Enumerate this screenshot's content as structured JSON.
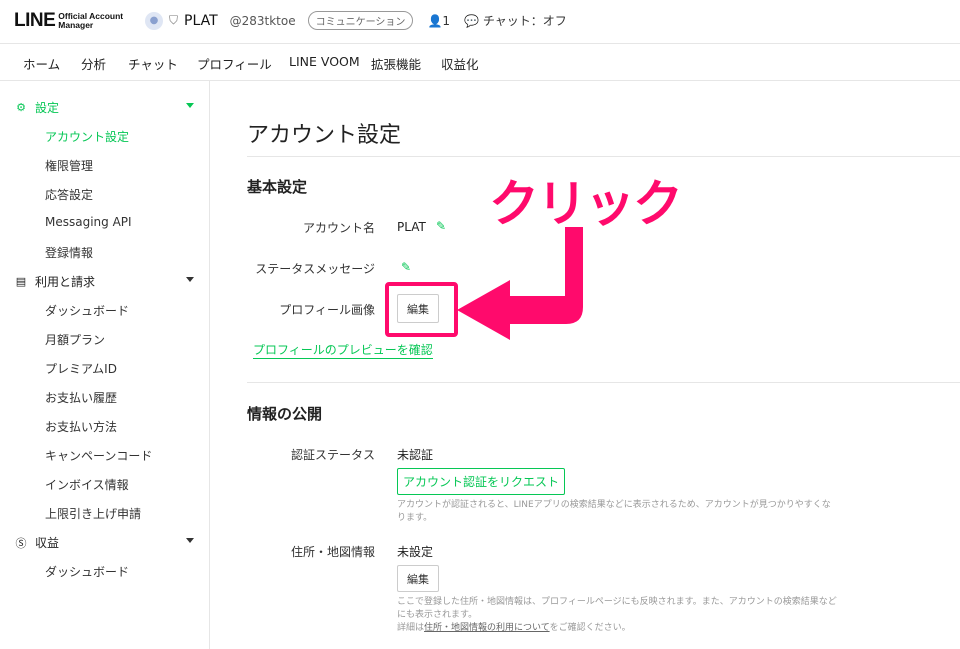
{
  "header": {
    "logo_main": "LINE",
    "logo_sub": "Official Account Manager",
    "account_name": "PLAT",
    "account_id": "@283tktoe",
    "badge": "コミュニケーション",
    "member_count": "1",
    "chat_status": "チャット：オフ"
  },
  "nav": {
    "items": [
      "ホーム",
      "分析",
      "チャット",
      "プロフィール",
      "LINE VOOM",
      "拡張機能",
      "収益化"
    ]
  },
  "sidebar": {
    "settings": {
      "title": "設定",
      "items": [
        "アカウント設定",
        "権限管理",
        "応答設定",
        "Messaging API",
        "登録情報"
      ]
    },
    "billing": {
      "title": "利用と請求",
      "items": [
        "ダッシュボード",
        "月額プラン",
        "プレミアムID",
        "お支払い履歴",
        "お支払い方法",
        "キャンペーンコード",
        "インボイス情報",
        "上限引き上げ申請"
      ]
    },
    "revenue": {
      "title": "収益",
      "items": [
        "ダッシュボード"
      ]
    }
  },
  "main": {
    "title": "アカウント設定",
    "basic": {
      "heading": "基本設定",
      "account_name_label": "アカウント名",
      "account_name_value": "PLAT",
      "status_label": "ステータスメッセージ",
      "profile_image_label": "プロフィール画像",
      "edit_button": "編集",
      "preview_link": "プロフィールのプレビューを確認"
    },
    "public": {
      "heading": "情報の公開",
      "verify_label": "認証ステータス",
      "verify_value": "未認証",
      "verify_button": "アカウント認証をリクエスト",
      "verify_note": "アカウントが認証されると、LINEアプリの検索結果などに表示されるため、アカウントが見つかりやすくなります。",
      "address_label": "住所・地図情報",
      "address_value": "未設定",
      "address_button": "編集",
      "address_note": "ここで登録した住所・地図情報は、プロフィールページにも反映されます。また、アカウントの検索結果などにも表示されます。",
      "address_note2_prefix": "詳細は",
      "address_note2_link": "住所・地図情報の利用について",
      "address_note2_suffix": "をご確認ください。"
    }
  },
  "annotation": {
    "text": "クリック",
    "color": "#ff0a6c"
  },
  "colors": {
    "accent": "#06c755"
  }
}
